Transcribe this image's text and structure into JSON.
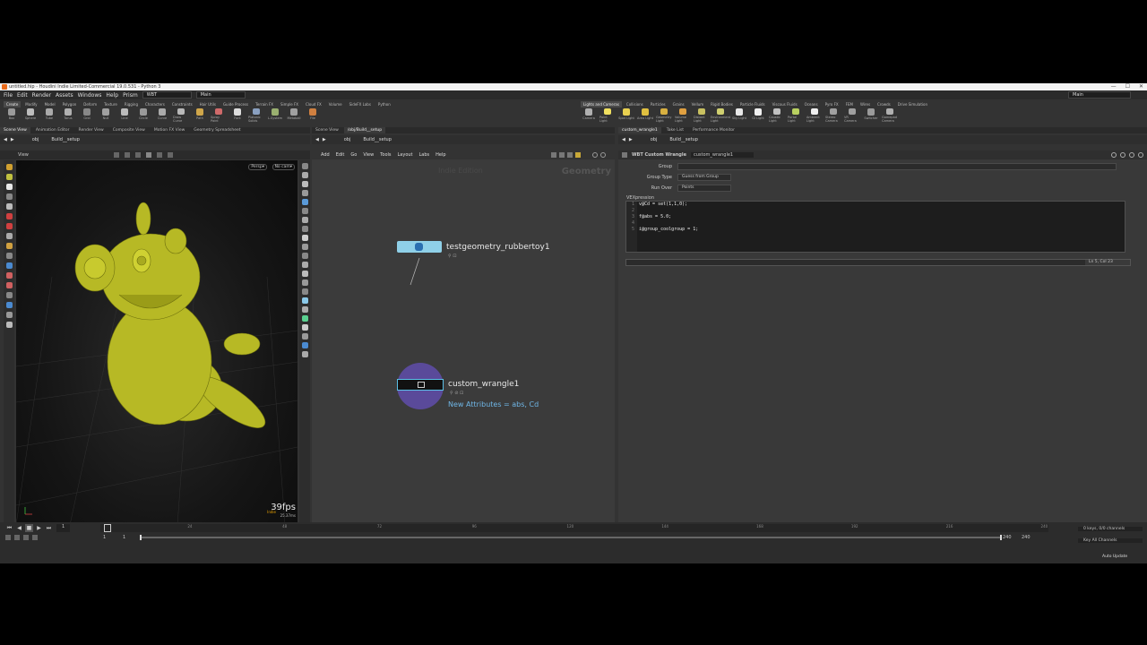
{
  "window": {
    "title": "untitled.hip - Houdini Indie Limited-Commercial 19.0.531 - Python 3",
    "minimize": "—",
    "maximize": "☐",
    "close": "✕"
  },
  "menu": {
    "items": [
      "File",
      "Edit",
      "Render",
      "Assets",
      "Windows",
      "Help",
      "Prism"
    ],
    "desktop_left": "WBT",
    "desktop_mid": "Main",
    "desktop_right": "Main"
  },
  "shelf_left": {
    "tabs": [
      "Create",
      "Modify",
      "Model",
      "Polygon",
      "Deform",
      "Texture",
      "Rigging",
      "Characters",
      "Constraints",
      "Hair Utils",
      "Guide Process",
      "Terrain FX",
      "Simple FX",
      "Cloud FX",
      "Volume",
      "SideFX Labs",
      "Python"
    ],
    "tools": [
      "Box",
      "Sphere",
      "Tube",
      "Torus",
      "Grid",
      "Null",
      "Line",
      "Circle",
      "Curve",
      "Draw Curve",
      "Path",
      "Spray Paint",
      "Font",
      "Platonic Solids",
      "L-System",
      "Metaball",
      "File"
    ],
    "tool_colors": [
      "#9a9a9a",
      "#bdbdbd",
      "#aaaaaa",
      "#b0b0b0",
      "#888888",
      "#a0a0a0",
      "#bbbbbb",
      "#999999",
      "#aaaaaa",
      "#b8b8b8",
      "#cfa64a",
      "#d06a6a",
      "#dddddd",
      "#8aa0c0",
      "#9ab070",
      "#a0a0a0",
      "#d08040"
    ]
  },
  "shelf_right": {
    "tabs": [
      "Lights and Cameras",
      "Collisions",
      "Particles",
      "Grains",
      "Vellum",
      "Rigid Bodies",
      "Particle Fluids",
      "Viscous Fluids",
      "Oceans",
      "Pyro FX",
      "FEM",
      "Wires",
      "Crowds",
      "Drive Simulation"
    ],
    "tools": [
      "Camera",
      "Point Light",
      "Spot Light",
      "Area Light",
      "Geometry Light",
      "Volume Light",
      "Distant Light",
      "Environment Light",
      "Sky Light",
      "GI Light",
      "Caustic Light",
      "Portal Light",
      "Ambient Light",
      "Stereo Camera",
      "VR Camera",
      "Switcher",
      "Gamepad Camera"
    ],
    "tool_colors": [
      "#b0b0b0",
      "#f0e060",
      "#e8d050",
      "#e0c040",
      "#d8b040",
      "#e0a040",
      "#c8c060",
      "#d0d070",
      "#e8e8e8",
      "#f0f0f0",
      "#c0c0c0",
      "#b8d060",
      "#f0f0f0",
      "#a0a0a0",
      "#a0a0a0",
      "#9a9a9a",
      "#b0b0b0"
    ]
  },
  "left_pane": {
    "tabs": [
      "Scene View",
      "Animation Editor",
      "Render View",
      "Composite View",
      "Motion FX View",
      "Geometry Spreadsheet"
    ],
    "path_obj": "obj",
    "path_node": "Build__setup",
    "view_label": "View",
    "persp": "Persp▾",
    "cam": "No cam▾",
    "fps": "39fps",
    "fps_sub": "25.37ms",
    "indie": "Indie"
  },
  "mid_pane": {
    "tabs": [
      "Scene View",
      "/obj/Build__setup"
    ],
    "path_obj": "obj",
    "path_node": "Build__setup",
    "menu": [
      "Add",
      "Edit",
      "Go",
      "View",
      "Tools",
      "Layout",
      "Labs",
      "Help"
    ],
    "watermark": "Indie Edition",
    "context": "Geometry",
    "node1_name": "testgeometry_rubbertoy1",
    "node2_name": "custom_wrangle1",
    "node2_info": "New Attributes = abs, Cd"
  },
  "right_pane": {
    "tabs": [
      "custom_wrangle1",
      "Take List",
      "Performance Monitor"
    ],
    "path_obj": "obj",
    "path_node": "Build__setup",
    "node_type": "WBT Custom Wrangle",
    "node_name": "custom_wrangle1",
    "group_label": "Group",
    "group_type_label": "Group Type",
    "group_type_value": "Guess from Group",
    "run_over_label": "Run Over",
    "run_over_value": "Points",
    "vex_label": "VEXpression",
    "vex_lines": [
      "v@Cd = set(1,1,0);",
      "",
      "f@abs = 5.0;",
      "",
      "i@group_coolgroup = 1;"
    ],
    "cursor_pos": "Ln 5, Col 23"
  },
  "timeline": {
    "frame": "1",
    "start": "1",
    "start2": "1",
    "end": "240",
    "end2": "240",
    "ticks": [
      "24",
      "48",
      "72",
      "96",
      "120",
      "144",
      "168",
      "192",
      "216",
      "240"
    ],
    "keys": "0 keys, 0/0 channels",
    "key_all": "Key All Channels",
    "auto_update": "Auto Update"
  }
}
